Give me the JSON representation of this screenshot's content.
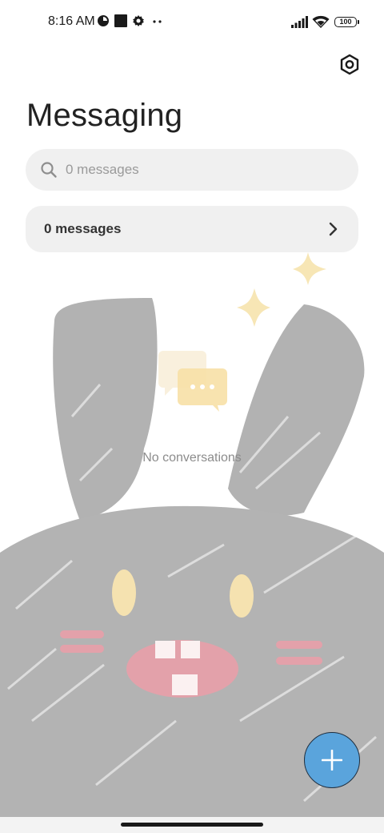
{
  "status_bar": {
    "time": "8:16 AM",
    "battery": "100",
    "icons": [
      "data-saver-icon",
      "square-notification-icon",
      "gear-notification-icon",
      "more-dots-icon",
      "signal-icon",
      "wifi-icon",
      "battery-icon"
    ]
  },
  "header": {
    "title": "Messaging",
    "settings_icon": "settings-hexagon-icon"
  },
  "search": {
    "placeholder": "0 messages",
    "icon": "search-icon"
  },
  "messages_row": {
    "label": "0 messages",
    "icon": "chevron-right-icon"
  },
  "empty_state": {
    "text": "No conversations",
    "icon": "chat-bubbles-icon"
  },
  "fab": {
    "icon": "plus-icon",
    "color": "#5aa4dc"
  },
  "colors": {
    "wallpaper_gray": "#b3b3b3",
    "cheek_pink": "#e3a1aa",
    "eye_yellow": "#f5e2b0",
    "sparkle_yellow": "#f7e6b5"
  }
}
